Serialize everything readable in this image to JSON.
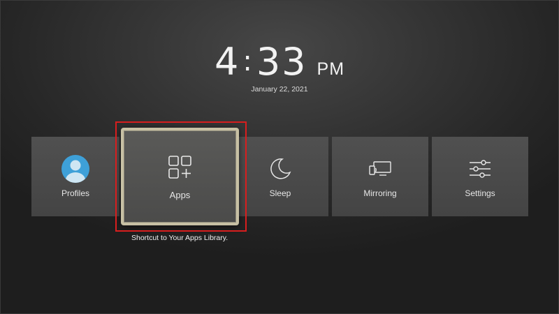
{
  "clock": {
    "hours": "4",
    "minutes": "33",
    "ampm": "PM",
    "date": "January 22, 2021"
  },
  "tiles": [
    {
      "label": "Profiles",
      "icon": "profile-avatar-icon"
    },
    {
      "label": "Apps",
      "icon": "apps-grid-icon",
      "focused": true
    },
    {
      "label": "Sleep",
      "icon": "moon-icon"
    },
    {
      "label": "Mirroring",
      "icon": "mirroring-icon"
    },
    {
      "label": "Settings",
      "icon": "sliders-icon"
    }
  ],
  "tooltip": "Shortcut to Your Apps Library.",
  "colors": {
    "highlight": "#d81e1e",
    "focus_border": "#c7c0a4",
    "avatar": "#3ea0d8"
  }
}
